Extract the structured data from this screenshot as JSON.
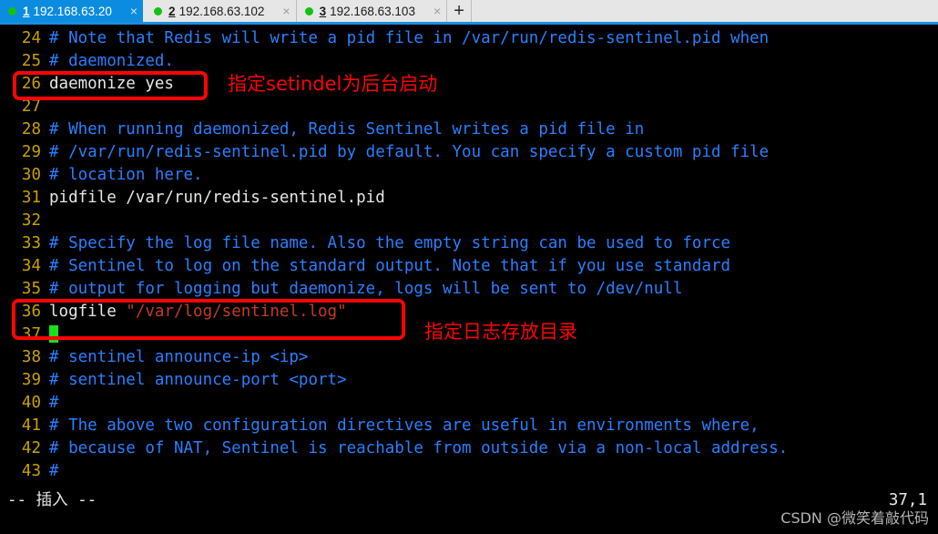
{
  "tabbar": {
    "new_tab_label": "+",
    "close_label": "×",
    "tabs": [
      {
        "index": "1",
        "title": "192.168.63.20",
        "active": true,
        "status_color": "#12c212"
      },
      {
        "index": "2",
        "title": "192.168.63.102",
        "active": false,
        "status_color": "#12c212"
      },
      {
        "index": "3",
        "title": "192.168.63.103",
        "active": false,
        "status_color": "#12c212"
      }
    ]
  },
  "terminal": {
    "colors": {
      "background": "#000000",
      "line_number": "#c9a000",
      "comment": "#2a7fff",
      "plain_text": "#e6e6e6",
      "string": "#c23b22",
      "cursor": "#19e019",
      "annotation": "#fb0404"
    },
    "lines": [
      {
        "num": "24",
        "segments": [
          {
            "text": "# Note that Redis will write a pid file in /var/run/redis-sentinel.pid when",
            "cls": "cmt"
          }
        ]
      },
      {
        "num": "25",
        "segments": [
          {
            "text": "# daemonized.",
            "cls": "cmt"
          }
        ]
      },
      {
        "num": "26",
        "segments": [
          {
            "text": "daemonize yes",
            "cls": "plain"
          }
        ]
      },
      {
        "num": "27",
        "segments": [
          {
            "text": "",
            "cls": "plain"
          }
        ]
      },
      {
        "num": "28",
        "segments": [
          {
            "text": "# When running daemonized, Redis Sentinel writes a pid file in",
            "cls": "cmt"
          }
        ]
      },
      {
        "num": "29",
        "segments": [
          {
            "text": "# /var/run/redis-sentinel.pid by default. You can specify a custom pid file",
            "cls": "cmt"
          }
        ]
      },
      {
        "num": "30",
        "segments": [
          {
            "text": "# location here.",
            "cls": "cmt"
          }
        ]
      },
      {
        "num": "31",
        "segments": [
          {
            "text": "pidfile /var/run/redis-sentinel.pid",
            "cls": "plain"
          }
        ]
      },
      {
        "num": "32",
        "segments": [
          {
            "text": "",
            "cls": "plain"
          }
        ]
      },
      {
        "num": "33",
        "segments": [
          {
            "text": "# Specify the log file name. Also the empty string can be used to force",
            "cls": "cmt"
          }
        ]
      },
      {
        "num": "34",
        "segments": [
          {
            "text": "# Sentinel to log on the standard output. Note that if you use standard",
            "cls": "cmt"
          }
        ]
      },
      {
        "num": "35",
        "segments": [
          {
            "text": "# output for logging but daemonize, logs will be sent to /dev/null",
            "cls": "cmt"
          }
        ]
      },
      {
        "num": "36",
        "segments": [
          {
            "text": "logfile ",
            "cls": "plain"
          },
          {
            "text": "\"/var/log/sentinel.log\"",
            "cls": "str"
          }
        ]
      },
      {
        "num": "37",
        "segments": [
          {
            "text": "",
            "cls": "plain",
            "cursor": true
          }
        ]
      },
      {
        "num": "38",
        "segments": [
          {
            "text": "# sentinel announce-ip <ip>",
            "cls": "cmt"
          }
        ]
      },
      {
        "num": "39",
        "segments": [
          {
            "text": "# sentinel announce-port <port>",
            "cls": "cmt"
          }
        ]
      },
      {
        "num": "40",
        "segments": [
          {
            "text": "#",
            "cls": "cmt"
          }
        ]
      },
      {
        "num": "41",
        "segments": [
          {
            "text": "# The above two configuration directives are useful in environments where,",
            "cls": "cmt"
          }
        ]
      },
      {
        "num": "42",
        "segments": [
          {
            "text": "# because of NAT, Sentinel is reachable from outside via a non-local address.",
            "cls": "cmt"
          }
        ]
      },
      {
        "num": "43",
        "segments": [
          {
            "text": "#",
            "cls": "cmt"
          }
        ]
      }
    ],
    "annotations": [
      {
        "id": "annot-daemonize",
        "text": "指定setindel为后台启动"
      },
      {
        "id": "annot-logfile",
        "text": "指定日志存放目录"
      }
    ],
    "status": {
      "mode": "-- 插入 --",
      "position": "37,1"
    }
  },
  "watermark": {
    "text": "CSDN @微笑着敲代码"
  }
}
